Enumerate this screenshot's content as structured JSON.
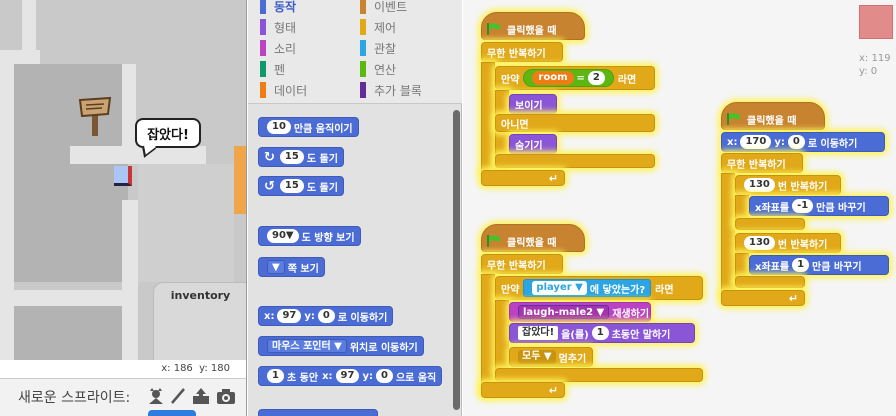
{
  "stage": {
    "bubble_text": "잡았다!",
    "inventory_label": "inventory",
    "mouse_x_label": "x:",
    "mouse_x": "186",
    "mouse_y_label": "y:",
    "mouse_y": "180"
  },
  "sprite_bar": {
    "label": "새로운 스프라이트:"
  },
  "categories": [
    {
      "label": "동작",
      "color": "#4a6cd4",
      "active": true
    },
    {
      "label": "이벤트",
      "color": "#c88330"
    },
    {
      "label": "형태",
      "color": "#8a55d7"
    },
    {
      "label": "제어",
      "color": "#e1a91a"
    },
    {
      "label": "소리",
      "color": "#bb42c3"
    },
    {
      "label": "관찰",
      "color": "#2ca5e2"
    },
    {
      "label": "펜",
      "color": "#0e9a6c"
    },
    {
      "label": "연산",
      "color": "#5cb712"
    },
    {
      "label": "데이터",
      "color": "#ee7d16"
    },
    {
      "label": "추가 블록",
      "color": "#632d99"
    }
  ],
  "palette": {
    "move": {
      "value": "10",
      "text": "만큼 움직이기"
    },
    "turn_right": {
      "value": "15",
      "text": "도 돌기"
    },
    "turn_left": {
      "value": "15",
      "text": "도 돌기"
    },
    "point_dir": {
      "value": "90▼",
      "text": "도 방향 보기"
    },
    "point_towards": {
      "text": "쪽 보기"
    },
    "goto_xy": {
      "x_label": "x:",
      "x": "97",
      "y_label": "y:",
      "y": "0",
      "text": "로 이동하기"
    },
    "goto": {
      "target": "마우스 포인터",
      "text": "위치로 이동하기"
    },
    "glide": {
      "secs": "1",
      "t1": "초 동안",
      "x_label": "x:",
      "x": "97",
      "y_label": "y:",
      "y": "0",
      "t2": "으로 움직"
    }
  },
  "scripts": {
    "s1": {
      "hat": "클릭했을 때",
      "forever": "무한 반복하기",
      "if": "만약",
      "var": "room",
      "eq": "=",
      "eq_val": "2",
      "then": "라면",
      "show": "보이기",
      "else": "아니면",
      "hide": "숨기기"
    },
    "s2": {
      "hat": "클릭했을 때",
      "forever": "무한 반복하기",
      "if": "만약",
      "touch_target": "player",
      "touch_text": "에 닿았는가?",
      "then": "라면",
      "sound": "laugh-male2",
      "sound_text": "재생하기",
      "say_val": "잡았다!",
      "say_text": "을(를)",
      "say_secs": "1",
      "say_text2": "초동안 말하기",
      "stop_val": "모두",
      "stop_text": "멈추기"
    },
    "s3": {
      "hat": "클릭했을 때",
      "goto_x_label": "x:",
      "goto_x": "170",
      "goto_y_label": "y:",
      "goto_y": "0",
      "goto_text": "로 이동하기",
      "forever": "무한 반복하기",
      "repeat1_val": "130",
      "repeat1_text": "번 반복하기",
      "change_x1_text": "x좌표를",
      "change_x1_val": "-1",
      "change_x1_text2": "만큼 바꾸기",
      "repeat2_val": "130",
      "repeat2_text": "번 반복하기",
      "change_x2_text": "x좌표를",
      "change_x2_val": "1",
      "change_x2_text2": "만큼 바꾸기"
    }
  },
  "sprite_info": {
    "x_label": "x:",
    "x_val": "119",
    "y_label": "y:",
    "y_val": "0"
  }
}
